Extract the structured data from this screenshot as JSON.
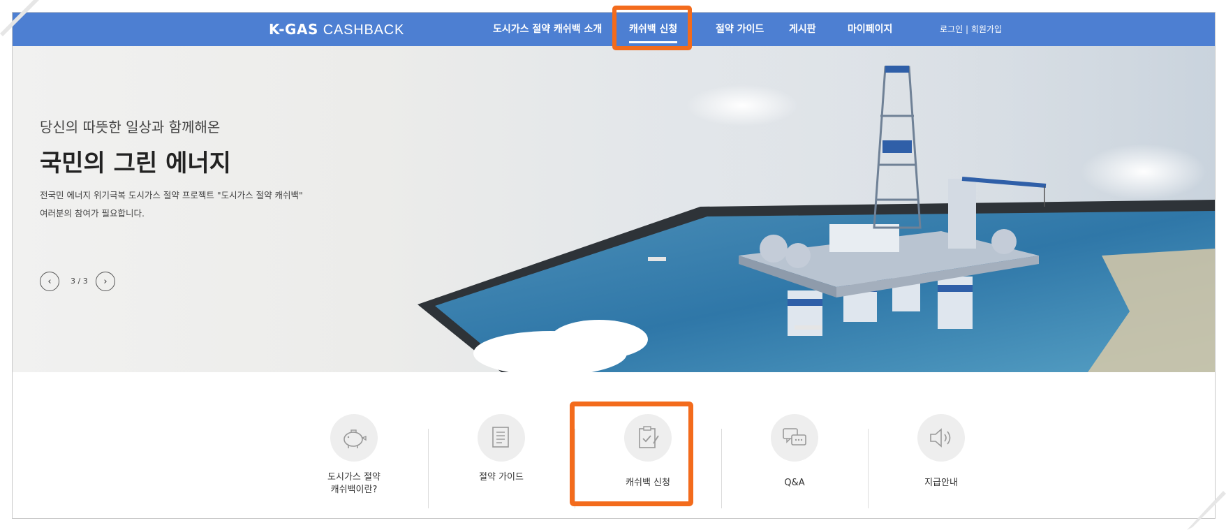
{
  "header": {
    "logo_bold": "K-GAS",
    "logo_light": "CASHBACK",
    "nav": [
      {
        "label": "도시가스 절약 캐쉬백 소개"
      },
      {
        "label": "캐쉬백 신청"
      },
      {
        "label": "절약 가이드"
      },
      {
        "label": "게시판"
      },
      {
        "label": "마이페이지"
      }
    ],
    "login": "로그인",
    "separator": "|",
    "signup": "회원가입",
    "bg_color": "#4d7fd2",
    "highlight_color": "#f36b1c"
  },
  "hero": {
    "subtitle": "당신의 따뜻한 일상과 함께해온",
    "title": "국민의 그린 에너지",
    "desc_line1": "전국민 에너지 위기극복 도시가스 절약 프로젝트 \"도시가스 절약 캐쉬백\"",
    "desc_line2": "여러분의 참여가 필요합니다.",
    "pager": "3 / 3",
    "prev_icon": "chevron-left-icon",
    "next_icon": "chevron-right-icon"
  },
  "quick_menu": [
    {
      "label": "도시가스 절약\n캐쉬백이란?",
      "icon": "piggy-bank-icon"
    },
    {
      "label": "절약 가이드",
      "icon": "document-icon"
    },
    {
      "label": "캐쉬백 신청",
      "icon": "clipboard-check-icon"
    },
    {
      "label": "Q&A",
      "icon": "chat-bubbles-icon"
    },
    {
      "label": "지급안내",
      "icon": "speaker-icon"
    }
  ]
}
